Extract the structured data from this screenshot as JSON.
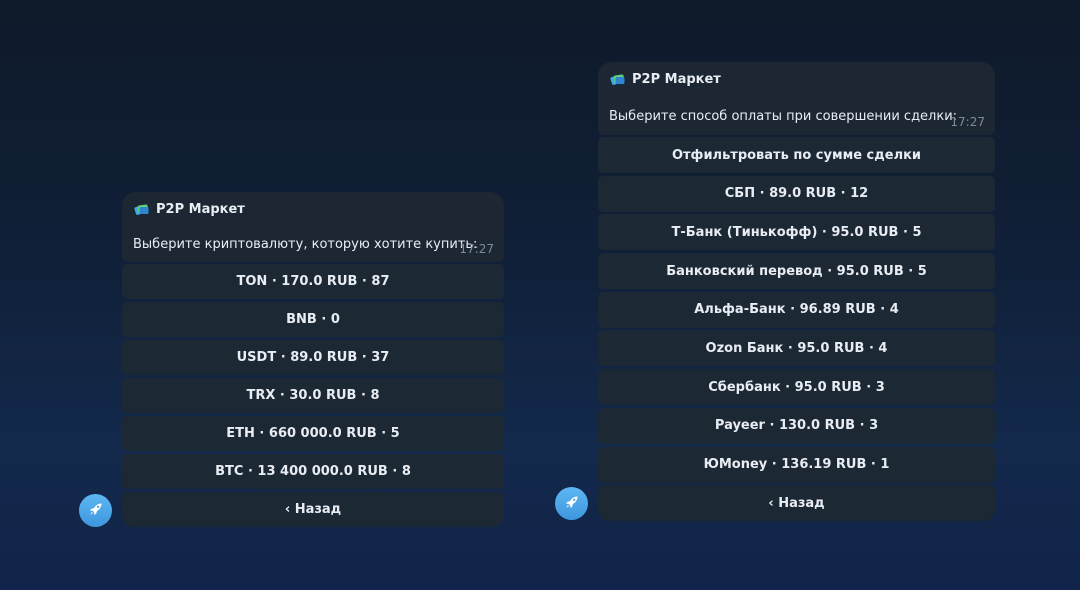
{
  "chat_left": {
    "sender": "P2P Маркет",
    "message": "Выберите криптовалюту, которую хотите купить:",
    "time": "17:27",
    "buttons": [
      "TON · 170.0 RUB · 87",
      "BNB · 0",
      "USDT · 89.0 RUB · 37",
      "TRX · 30.0 RUB · 8",
      "ETH · 660 000.0 RUB · 5",
      "BTC · 13 400 000.0 RUB · 8",
      "‹ Назад"
    ]
  },
  "chat_right": {
    "sender": "P2P Маркет",
    "message": "Выберите способ оплаты при совершении сделки:",
    "time": "17:27",
    "buttons": [
      "Отфильтровать по сумме сделки",
      "СБП · 89.0 RUB · 12",
      "Т-Банк (Тинькофф) · 95.0 RUB · 5",
      "Банковский перевод · 95.0 RUB · 5",
      "Альфа-Банк · 96.89 RUB · 4",
      "Ozon Банк · 95.0 RUB · 4",
      "Сбербанк · 95.0 RUB · 3",
      "Payeer · 130.0 RUB · 3",
      "ЮMoney · 136.19 RUB · 1",
      "‹ Назад"
    ]
  },
  "icons": {
    "sender": "wallet-cards-icon",
    "avatar": "rocket-icon"
  },
  "colors": {
    "accent": "#4aa6e8",
    "bubble": "#1c2733",
    "button": "#1d2835",
    "time": "#7c8b9b"
  }
}
